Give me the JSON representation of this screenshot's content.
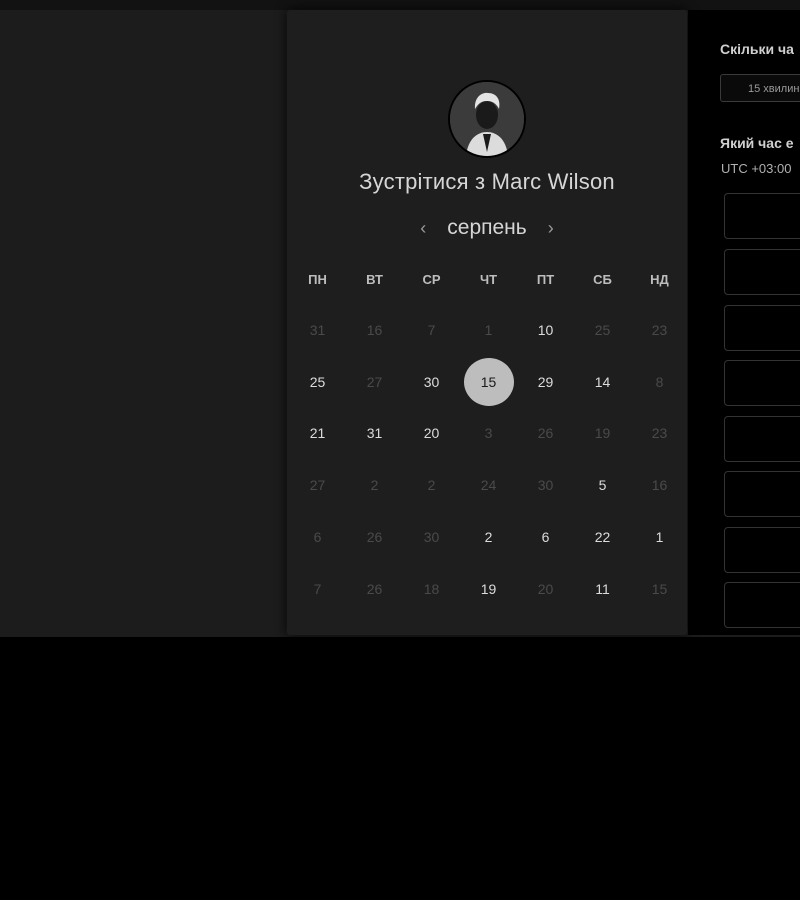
{
  "booking": {
    "title_prefix": "Зустрітися з",
    "host_name": "Marc Wilson",
    "month": "серпень"
  },
  "icons": {
    "prev": "chevron-left-icon",
    "next": "chevron-right-icon",
    "avatar": "host-avatar"
  },
  "calendar": {
    "weekdays": [
      "ПН",
      "ВТ",
      "СР",
      "ЧТ",
      "ПТ",
      "СБ",
      "НД"
    ],
    "weeks": [
      [
        {
          "d": "31",
          "on": false
        },
        {
          "d": "16",
          "on": false
        },
        {
          "d": "7",
          "on": false
        },
        {
          "d": "1",
          "on": false
        },
        {
          "d": "10",
          "on": true
        },
        {
          "d": "25",
          "on": false
        },
        {
          "d": "23",
          "on": false
        }
      ],
      [
        {
          "d": "25",
          "on": true
        },
        {
          "d": "27",
          "on": false
        },
        {
          "d": "30",
          "on": true
        },
        {
          "d": "15",
          "on": true,
          "selected": true
        },
        {
          "d": "29",
          "on": true
        },
        {
          "d": "14",
          "on": true
        },
        {
          "d": "8",
          "on": false
        }
      ],
      [
        {
          "d": "21",
          "on": true
        },
        {
          "d": "31",
          "on": true
        },
        {
          "d": "20",
          "on": true
        },
        {
          "d": "3",
          "on": false
        },
        {
          "d": "26",
          "on": false
        },
        {
          "d": "19",
          "on": false
        },
        {
          "d": "23",
          "on": false
        }
      ],
      [
        {
          "d": "27",
          "on": false
        },
        {
          "d": "2",
          "on": false
        },
        {
          "d": "2",
          "on": false
        },
        {
          "d": "24",
          "on": false
        },
        {
          "d": "30",
          "on": false
        },
        {
          "d": "5",
          "on": true
        },
        {
          "d": "16",
          "on": false
        }
      ],
      [
        {
          "d": "6",
          "on": false
        },
        {
          "d": "26",
          "on": false
        },
        {
          "d": "30",
          "on": false
        },
        {
          "d": "2",
          "on": true
        },
        {
          "d": "6",
          "on": true
        },
        {
          "d": "22",
          "on": true
        },
        {
          "d": "1",
          "on": true
        }
      ],
      [
        {
          "d": "7",
          "on": false
        },
        {
          "d": "26",
          "on": false
        },
        {
          "d": "18",
          "on": false
        },
        {
          "d": "19",
          "on": true
        },
        {
          "d": "20",
          "on": false
        },
        {
          "d": "11",
          "on": true
        },
        {
          "d": "15",
          "on": false
        }
      ]
    ]
  },
  "panel": {
    "duration_label": "Скільки ча",
    "duration_value": "15 хвилин",
    "time_label": "Який час е",
    "timezone": "UTC +03:00"
  },
  "colors": {
    "page": "#000000",
    "band": "#1c1c1c",
    "card": "#1e1e1e",
    "selected": "#bdbdbd"
  }
}
